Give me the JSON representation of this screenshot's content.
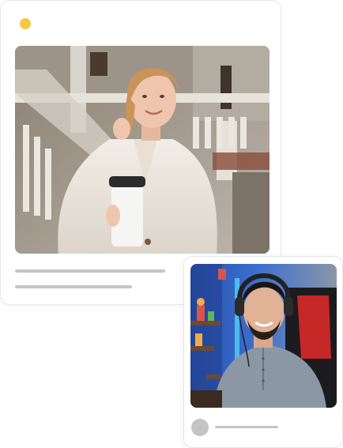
{
  "colors": {
    "status_dot": "#f5c842",
    "placeholder_line": "#c4c4c4",
    "avatar": "#c4c4c4",
    "card_border": "#e5e7eb"
  },
  "main_card": {
    "image": "photo-woman-with-coffee-cup",
    "text_lines": 2
  },
  "profile_card": {
    "image": "photo-man-with-headset",
    "text_lines": 1
  }
}
